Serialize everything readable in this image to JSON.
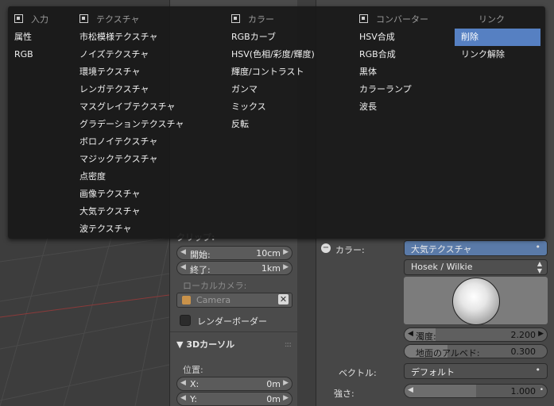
{
  "menu": {
    "columns": [
      {
        "header": "入力",
        "items": [
          "属性",
          "RGB"
        ]
      },
      {
        "header": "テクスチャ",
        "items": [
          "市松模様テクスチャ",
          "ノイズテクスチャ",
          "環境テクスチャ",
          "レンガテクスチャ",
          "マスグレイブテクスチャ",
          "グラデーションテクスチャ",
          "ボロノイテクスチャ",
          "マジックテクスチャ",
          "点密度",
          "画像テクスチャ",
          "大気テクスチャ",
          "波テクスチャ"
        ]
      },
      {
        "header": "カラー",
        "items": [
          "RGBカーブ",
          "HSV(色相/彩度/輝度)",
          "輝度/コントラスト",
          "ガンマ",
          "ミックス",
          "反転"
        ]
      },
      {
        "header": "コンバーター",
        "items": [
          "HSV合成",
          "RGB合成",
          "黒体",
          "カラーランプ",
          "波長"
        ]
      },
      {
        "header": "リンク",
        "items": [
          "削除",
          "リンク解除"
        ],
        "highlighted": 0
      }
    ]
  },
  "npanel": {
    "clip_header": "クリップ:",
    "clip_start_label": "開始:",
    "clip_start_value": "10cm",
    "clip_end_label": "終了:",
    "clip_end_value": "1km",
    "local_camera_label": "ローカルカメラ:",
    "local_camera_value": "Camera",
    "render_border_label": "レンダーボーダー",
    "cursor_header": "3Dカーソル",
    "location_label": "位置:",
    "x_label": "X:",
    "x_value": "0m",
    "y_label": "Y:",
    "y_value": "0m"
  },
  "props": {
    "color_label": "カラー:",
    "color_value": "大気テクスチャ",
    "sky_model": "Hosek / Wilkie",
    "turbidity_label": "濁度:",
    "turbidity_value": "2.200",
    "turbidity_fill": 0.22,
    "ground_albedo_label": "地面のアルベド:",
    "ground_albedo_value": "0.300",
    "ground_albedo_fill": 0.3,
    "vector_label": "ベクトル:",
    "vector_value": "デフォルト",
    "strength_label": "強さ:",
    "strength_value": "1.000",
    "strength_fill": 0.5
  },
  "colors": {
    "menu_highlight": "#5680c2",
    "menu_bg": "#191919",
    "color_field": "#5a7aa8"
  }
}
